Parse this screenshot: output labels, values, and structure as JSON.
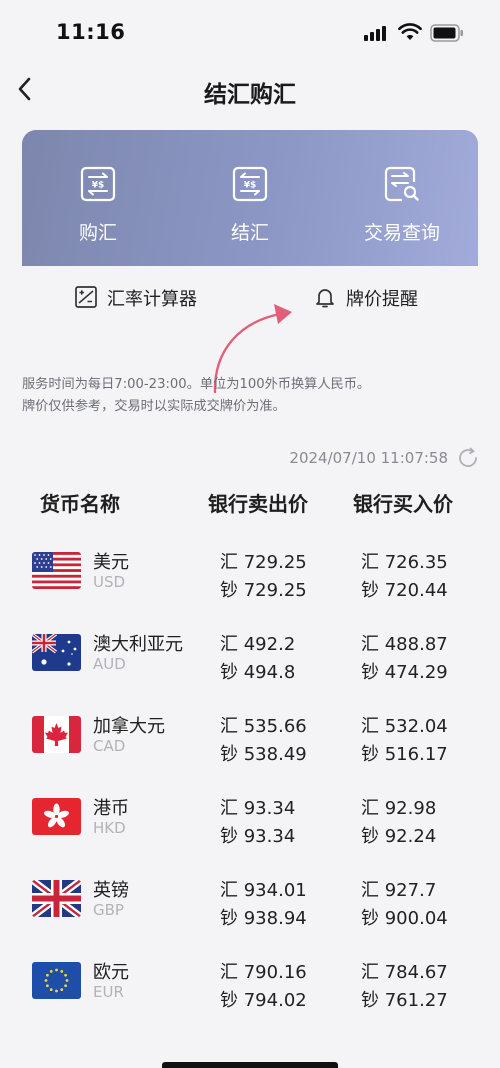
{
  "status": {
    "time": "11:16"
  },
  "nav": {
    "title": "结汇购汇"
  },
  "actions": [
    {
      "label": "购汇",
      "icon": "buy-exchange-icon"
    },
    {
      "label": "结汇",
      "icon": "settle-exchange-icon"
    },
    {
      "label": "交易查询",
      "icon": "transaction-query-icon"
    }
  ],
  "tools": {
    "calculator_label": "汇率计算器",
    "alert_label": "牌价提醒"
  },
  "notice": {
    "line1": "服务时间为每日7:00-23:00。单位为100外币换算人民币。",
    "line2": "牌价仅供参考，交易时以实际成交牌价为准。"
  },
  "updated_at": "2024/07/10 11:07:58",
  "table": {
    "headers": {
      "currency": "货币名称",
      "sell": "银行卖出价",
      "buy": "银行买入价"
    },
    "prefix_exchange": "汇",
    "prefix_cash": "钞",
    "rows": [
      {
        "name": "美元",
        "code": "USD",
        "flag": "us-flag",
        "sell_exchange": "729.25",
        "sell_cash": "729.25",
        "buy_exchange": "726.35",
        "buy_cash": "720.44"
      },
      {
        "name": "澳大利亚元",
        "code": "AUD",
        "flag": "au-flag",
        "sell_exchange": "492.2",
        "sell_cash": "494.8",
        "buy_exchange": "488.87",
        "buy_cash": "474.29"
      },
      {
        "name": "加拿大元",
        "code": "CAD",
        "flag": "ca-flag",
        "sell_exchange": "535.66",
        "sell_cash": "538.49",
        "buy_exchange": "532.04",
        "buy_cash": "516.17"
      },
      {
        "name": "港币",
        "code": "HKD",
        "flag": "hk-flag",
        "sell_exchange": "93.34",
        "sell_cash": "93.34",
        "buy_exchange": "92.98",
        "buy_cash": "92.24"
      },
      {
        "name": "英镑",
        "code": "GBP",
        "flag": "gb-flag",
        "sell_exchange": "934.01",
        "sell_cash": "938.94",
        "buy_exchange": "927.7",
        "buy_cash": "900.04"
      },
      {
        "name": "欧元",
        "code": "EUR",
        "flag": "eu-flag",
        "sell_exchange": "790.16",
        "sell_cash": "794.02",
        "buy_exchange": "784.67",
        "buy_cash": "761.27"
      }
    ]
  },
  "colors": {
    "banner": "#8c97c6",
    "annotation_arrow": "#e0607a"
  }
}
